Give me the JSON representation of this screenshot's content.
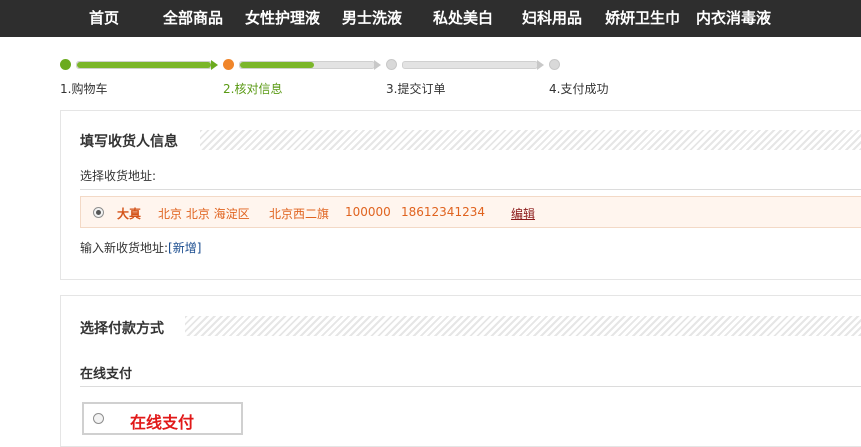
{
  "nav": {
    "items": [
      {
        "label": "首页"
      },
      {
        "label": "全部商品"
      },
      {
        "label": "女性护理液"
      },
      {
        "label": "男士洗液"
      },
      {
        "label": "私处美白"
      },
      {
        "label": "妇科用品"
      },
      {
        "label": "娇妍卫生巾"
      },
      {
        "label": "内衣消毒液"
      }
    ]
  },
  "steps": {
    "current": 2,
    "items": [
      {
        "label": "1.购物车"
      },
      {
        "label": "2.核对信息"
      },
      {
        "label": "3.提交订单"
      },
      {
        "label": "4.支付成功"
      }
    ]
  },
  "address": {
    "section_title": "填写收货人信息",
    "select_label": "选择收货地址:",
    "selected": {
      "name": "大真",
      "location": "北京 北京 海淀区",
      "street": "北京西二旗",
      "postcode": "100000",
      "phone": "18612341234",
      "edit_label": "编辑"
    },
    "new_prefix": "输入新收货地址:",
    "new_link": "[新增]"
  },
  "payment": {
    "section_title": "选择付款方式",
    "online_heading": "在线支付",
    "option_label": "在线支付"
  },
  "colors": {
    "nav_bg": "#2e2e2e",
    "step_green": "#6bab1e",
    "step_current": "#f0852a",
    "address_text": "#e0631f",
    "pay_label": "#e11919"
  }
}
